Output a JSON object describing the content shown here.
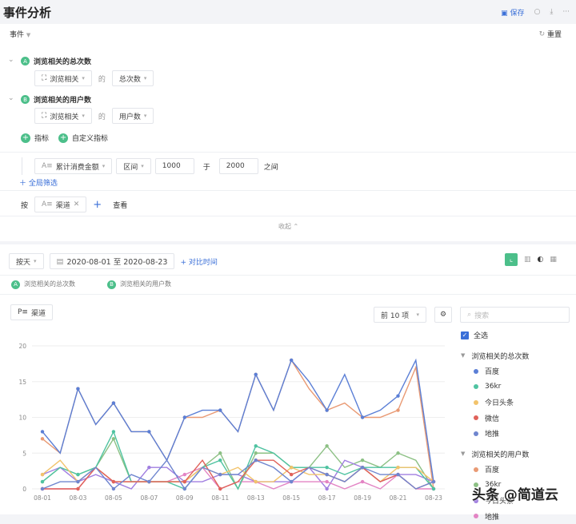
{
  "header": {
    "title": "事件分析",
    "save": "保存"
  },
  "events": {
    "label": "事件",
    "reset": "重置",
    "metrics": [
      {
        "badge": "A",
        "name": "浏览相关的总次数",
        "event": "浏览相关",
        "of": "的",
        "measure": "总次数"
      },
      {
        "badge": "B",
        "name": "浏览相关的用户数",
        "event": "浏览相关",
        "of": "的",
        "measure": "用户数"
      }
    ],
    "add_metric": "指标",
    "add_custom": "自定义指标"
  },
  "filter": {
    "property": "累计消费金额",
    "op": "区间",
    "from": "1000",
    "and": "于",
    "to": "2000",
    "between": "之间",
    "add_global": "全局筛选"
  },
  "groupby": {
    "by": "按",
    "property": "渠道",
    "view": "查看"
  },
  "collapse": "收起",
  "toolbar": {
    "granularity": "按天",
    "date_range": "2020-08-01 至 2020-08-23",
    "compare": "+ 对比时间"
  },
  "metric_tabs": [
    {
      "badge": "A",
      "label": "浏览相关的总次数"
    },
    {
      "badge": "B",
      "label": "浏览相关的用户数"
    }
  ],
  "dimension_button": "渠道",
  "topn": "前 10 项",
  "search_placeholder": "搜索",
  "select_all": "全选",
  "watermark": "头条 @简道云",
  "chart_data": {
    "type": "line",
    "categories": [
      "08-01",
      "08-02",
      "08-03",
      "08-04",
      "08-05",
      "08-06",
      "08-07",
      "08-08",
      "08-09",
      "08-10",
      "08-11",
      "08-12",
      "08-13",
      "08-14",
      "08-15",
      "08-16",
      "08-17",
      "08-18",
      "08-19",
      "08-20",
      "08-21",
      "08-22",
      "08-23"
    ],
    "tick_labels": [
      "08-01",
      "08-03",
      "08-05",
      "08-07",
      "08-09",
      "08-11",
      "08-13",
      "08-15",
      "08-17",
      "08-19",
      "08-21",
      "08-23"
    ],
    "ylim": [
      0,
      20
    ],
    "yticks": [
      0,
      5,
      10,
      15,
      20
    ],
    "grid": true,
    "legend": "right",
    "groups": [
      {
        "name": "浏览相关的总次数",
        "series": [
          {
            "name": "百度",
            "color": "#5b7fd6",
            "values": [
              8,
              5,
              14,
              9,
              12,
              8,
              8,
              4,
              10,
              11,
              11,
              8,
              16,
              11,
              18,
              15,
              11,
              16,
              10,
              11,
              13,
              18,
              1
            ]
          },
          {
            "name": "36kr",
            "color": "#4fc3a1",
            "values": [
              1,
              3,
              2,
              3,
              8,
              1,
              1,
              1,
              0,
              3,
              4,
              0,
              6,
              5,
              3,
              3,
              3,
              2,
              3,
              3,
              3,
              3,
              0
            ]
          },
          {
            "name": "今日头条",
            "color": "#f2c36b",
            "values": [
              2,
              4,
              1,
              3,
              1,
              1,
              1,
              1,
              1,
              3,
              2,
              3,
              1,
              1,
              3,
              2,
              2,
              1,
              3,
              1,
              3,
              3,
              1
            ]
          },
          {
            "name": "微信",
            "color": "#e0625a",
            "values": [
              0,
              0,
              0,
              3,
              1,
              1,
              1,
              1,
              1,
              4,
              0,
              1,
              4,
              4,
              2,
              3,
              2,
              1,
              3,
              1,
              2,
              0,
              1
            ]
          },
          {
            "name": "地推",
            "color": "#6f86cf",
            "values": [
              0,
              1,
              1,
              3,
              0,
              2,
              1,
              4,
              0,
              3,
              2,
              2,
              4,
              3,
              1,
              3,
              2,
              1,
              3,
              2,
              2,
              0,
              1
            ]
          }
        ]
      },
      {
        "name": "浏览相关的用户数",
        "series": [
          {
            "name": "百度",
            "color": "#e99a74",
            "values": [
              7,
              5,
              14,
              9,
              12,
              8,
              8,
              4,
              10,
              10,
              11,
              8,
              16,
              11,
              18,
              14,
              11,
              12,
              10,
              10,
              11,
              17,
              0
            ]
          },
          {
            "name": "36kr",
            "color": "#8cc084",
            "values": [
              1,
              3,
              2,
              3,
              7,
              1,
              1,
              1,
              1,
              3,
              5,
              0,
              5,
              5,
              3,
              3,
              6,
              3,
              4,
              3,
              5,
              4,
              0
            ]
          },
          {
            "name": "今日头条",
            "color": "#a07ee0",
            "values": [
              2,
              3,
              1,
              2,
              1,
              0,
              3,
              3,
              1,
              1,
              2,
              2,
              1,
              1,
              1,
              3,
              0,
              4,
              3,
              1,
              2,
              2,
              1
            ]
          },
          {
            "name": "地推",
            "color": "#e384c4",
            "values": [
              0,
              0,
              0,
              3,
              1,
              1,
              1,
              1,
              2,
              3,
              0,
              1,
              1,
              0,
              1,
              1,
              1,
              0,
              1,
              0,
              2,
              0,
              0
            ]
          }
        ]
      }
    ]
  }
}
